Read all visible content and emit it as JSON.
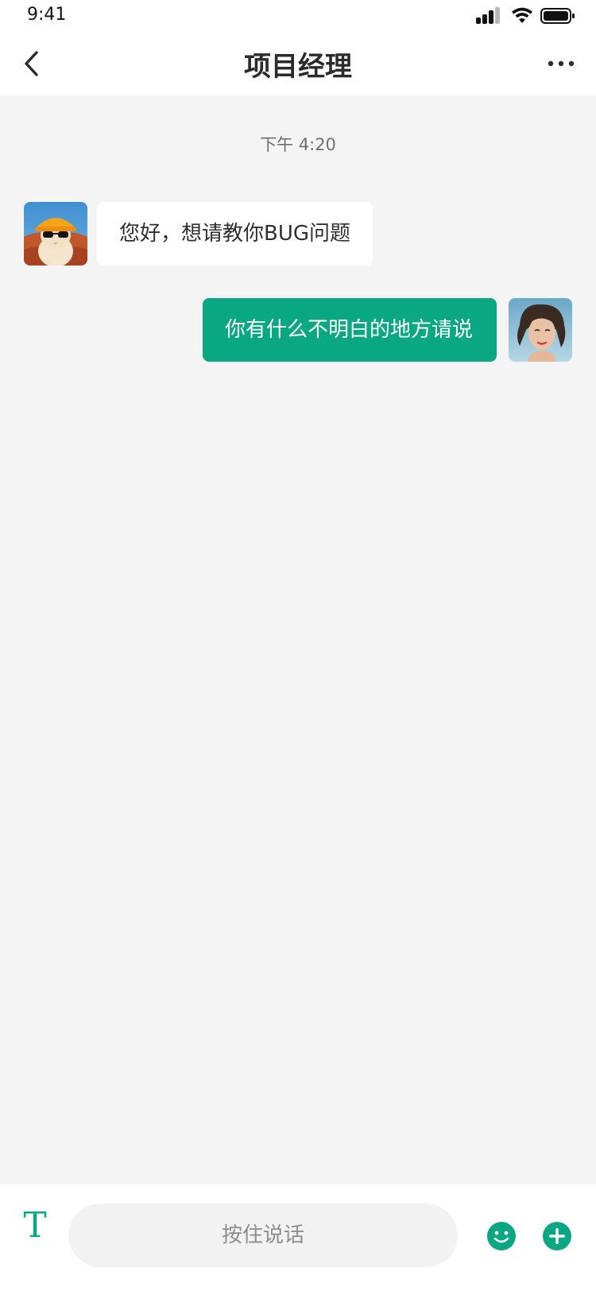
{
  "status_bar": {
    "time": "9:41",
    "icons": [
      "signal-icon",
      "wifi-icon",
      "battery-icon"
    ]
  },
  "nav": {
    "title": "项目经理",
    "back_icon": "chevron-left-icon",
    "more_icon": "more-horizontal-icon"
  },
  "chat": {
    "timestamp": "下午 4:20",
    "messages": [
      {
        "direction": "incoming",
        "text": "您好，想请教你BUG问题",
        "avatar": "cat-avatar"
      },
      {
        "direction": "outgoing",
        "text": "你有什么不明白的地方请说",
        "avatar": "user-avatar"
      }
    ]
  },
  "input_bar": {
    "mode_icon_glyph": "T",
    "hold_to_talk_label": "按住说话",
    "emoji_icon": "smile-icon",
    "plus_icon": "plus-circle-icon"
  },
  "colors": {
    "accent": "#0aa882",
    "background": "#f4f4f4",
    "surface": "#ffffff"
  }
}
